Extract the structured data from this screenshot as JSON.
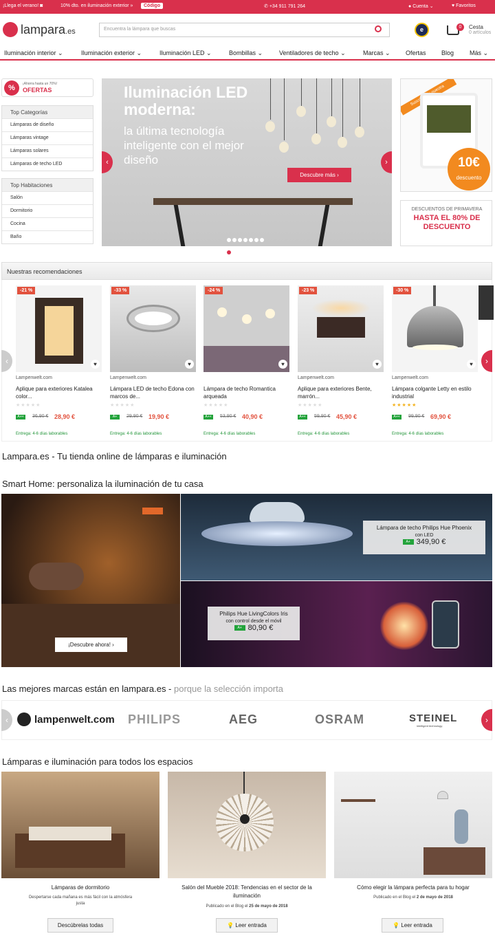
{
  "topbar": {
    "promo1": "¡Llega el verano!",
    "promo2": "10% dto. en iluminación exterior »",
    "code_label": "Código",
    "phone": "+34 911 791 264",
    "account": "Cuenta",
    "favorites": "Favoritos"
  },
  "header": {
    "logo_main": "lampara",
    "logo_tld": ".es",
    "search_placeholder": "Encuentra la lámpara que buscas",
    "trust_badge": "e",
    "cart_count": "0",
    "cart_label": "Cesta",
    "cart_items": "0 artículos"
  },
  "nav": {
    "items": [
      "Iluminación interior",
      "Iluminación exterior",
      "Iluminación LED",
      "Bombillas",
      "Ventiladores de techo",
      "Marcas",
      "Ofertas",
      "Blog",
      "Más"
    ]
  },
  "sidebar": {
    "ofertas_small": "¡Ahorra hasta un 70%!",
    "ofertas_title": "OFERTAS",
    "top_categories_title": "Top Categorías",
    "top_categories": [
      "Lámparas de diseño",
      "Lámparas vintage",
      "Lámparas solares",
      "Lámparas de techo LED"
    ],
    "top_rooms_title": "Top Habitaciones",
    "top_rooms": [
      "Salón",
      "Dormitorio",
      "Cocina",
      "Baño"
    ]
  },
  "hero": {
    "title": "Iluminación LED moderna:",
    "subtitle": "la última tecnología inteligente con el mejor diseño",
    "cta": "Descubre más",
    "slide_count": 8,
    "active_slide": 8
  },
  "newsletter": {
    "tab": "Suscríbete a nuestra NEWSLETTER",
    "amount": "10€",
    "amount_label": "descuento"
  },
  "promo_box": {
    "line1": "DESCUENTOS DE PRIMAVERA",
    "line2": "HASTA EL 80% DE DESCUENTO"
  },
  "recommendations": {
    "title": "Nuestras recomendaciones",
    "products": [
      {
        "discount": "-21 %",
        "shop": "Lampenwelt.com",
        "name": "Aplique para exteriores Katalea color...",
        "energy": "A++",
        "old_price": "36,90 €",
        "price": "28,90 €",
        "rating": 0,
        "delivery": "Entrega: 4-6 días laborables"
      },
      {
        "discount": "-33 %",
        "shop": "Lampenwelt.com",
        "name": "Lámpara LED de techo Edona con marcos de...",
        "energy": "A+",
        "old_price": "29,90 €",
        "price": "19,90 €",
        "rating": 0,
        "delivery": "Entrega: 4-6 días laborables"
      },
      {
        "discount": "-24 %",
        "shop": "",
        "name": "Lámpara de techo Romantica arqueada",
        "energy": "A++",
        "old_price": "53,90 €",
        "price": "40,90 €",
        "rating": 0,
        "delivery": "Entrega: 4-6 días laborables"
      },
      {
        "discount": "-23 %",
        "shop": "Lampenwelt.com",
        "name": "Aplique para exteriores Bente, marrón...",
        "energy": "A++",
        "old_price": "59,90 €",
        "price": "45,90 €",
        "rating": 0,
        "delivery": "Entrega: 4-6 días laborables"
      },
      {
        "discount": "-30 %",
        "shop": "Lampenwelt.com",
        "name": "Lámpara colgante Letty en estilo industrial",
        "energy": "A++",
        "old_price": "99,90 €",
        "price": "69,90 €",
        "rating": 5,
        "delivery": "Entrega: 4-6 días laborables"
      }
    ]
  },
  "online_store_title": "Lampara.es - Tu tienda online de lámparas e iluminación",
  "smart_home": {
    "title": "Smart Home: personaliza la iluminación de tu casa",
    "cta": "¡Descubre ahora!",
    "card1": {
      "name": "Lámpara de techo Philips Hue Phoenix",
      "sub": "con LED",
      "energy": "A+",
      "price": "349,90 €"
    },
    "card2": {
      "name": "Philips Hue LivingColors Iris",
      "sub": "con control desde el móvil",
      "energy": "A+",
      "price": "80,90 €"
    }
  },
  "brands": {
    "title": "Las mejores marcas están en lampara.es - ",
    "title_gray": "porque la selección importa",
    "items": [
      "lampenwelt.com",
      "PHILIPS",
      "AEG",
      "OSRAM",
      "STEINEL"
    ],
    "steinel_tag": "intelligent technology"
  },
  "spaces": {
    "title": "Lámparas e iluminación para todos los espacios",
    "items": [
      {
        "title": "Lámparas de dormitorio",
        "sub": "Despertarse cada mañana es más fácil con la atmósfera justa",
        "button": "Descúbrelas todas"
      },
      {
        "title": "Salón del Mueble 2018: Tendencias en el sector de la iluminación",
        "sub_prefix": "Publicado en el Blog el ",
        "sub_date": "25 de mayo de 2018",
        "button": "Leer entrada"
      },
      {
        "title": "Cómo elegir la lámpara perfecta para tu hogar",
        "sub_prefix": "Publicado en el Blog el ",
        "sub_date": "2 de mayo de 2018",
        "button": "Leer entrada"
      }
    ]
  },
  "colors": {
    "brand": "#d9304c",
    "discount": "#e2523e",
    "energy": "#23a33b",
    "accent_orange": "#f28a1f"
  }
}
